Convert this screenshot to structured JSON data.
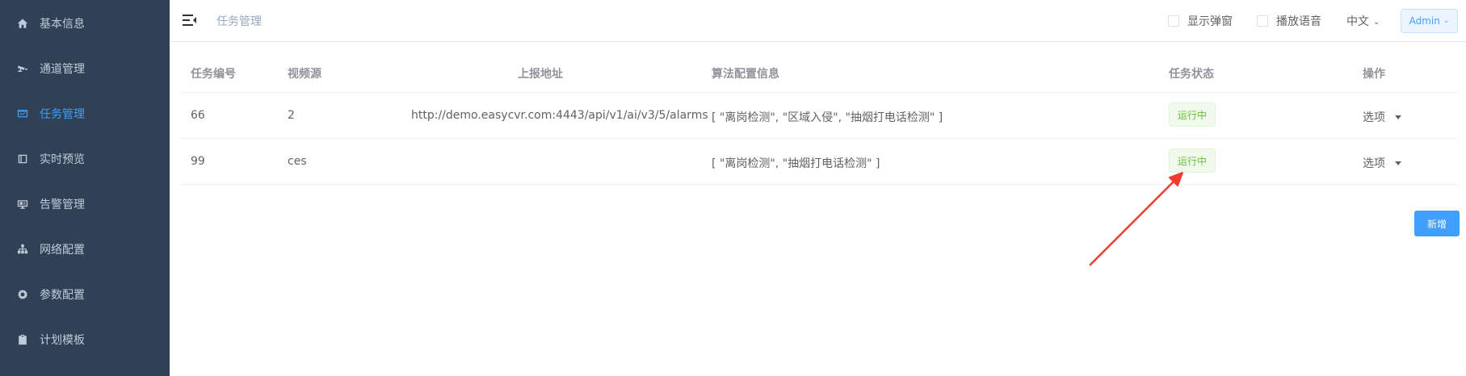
{
  "sidebar": {
    "bg": "#304156",
    "active_color": "#409eff",
    "items": [
      {
        "label": "基本信息",
        "icon": "home-icon"
      },
      {
        "label": "通道管理",
        "icon": "camera-icon"
      },
      {
        "label": "任务管理",
        "icon": "monitor-icon",
        "active": true
      },
      {
        "label": "实时预览",
        "icon": "book-icon"
      },
      {
        "label": "告警管理",
        "icon": "alarm-icon"
      },
      {
        "label": "网络配置",
        "icon": "network-icon"
      },
      {
        "label": "参数配置",
        "icon": "gear-icon"
      },
      {
        "label": "计划模板",
        "icon": "clipboard-icon"
      }
    ]
  },
  "header": {
    "breadcrumb": "任务管理",
    "show_popup_label": "显示弹窗",
    "play_voice_label": "播放语音",
    "language": "中文",
    "user": "Admin"
  },
  "table": {
    "columns": [
      "任务编号",
      "视频源",
      "上报地址",
      "算法配置信息",
      "任务状态",
      "操作"
    ],
    "rows": [
      {
        "id": "66",
        "source": "2",
        "url": "http://demo.easycvr.com:4443/api/v1/ai/v3/5/alarms",
        "algorithms": "[ \"离岗检测\", \"区域入侵\", \"抽烟打电话检测\" ]",
        "status": "运行中",
        "action": "选项"
      },
      {
        "id": "99",
        "source": "ces",
        "url": "",
        "algorithms": "[ \"离岗检测\", \"抽烟打电话检测\" ]",
        "status": "运行中",
        "action": "选项"
      }
    ]
  },
  "add_button": "新增",
  "colors": {
    "primary": "#409eff",
    "success": "#67c23a",
    "annotation_arrow": "#f03b32"
  }
}
